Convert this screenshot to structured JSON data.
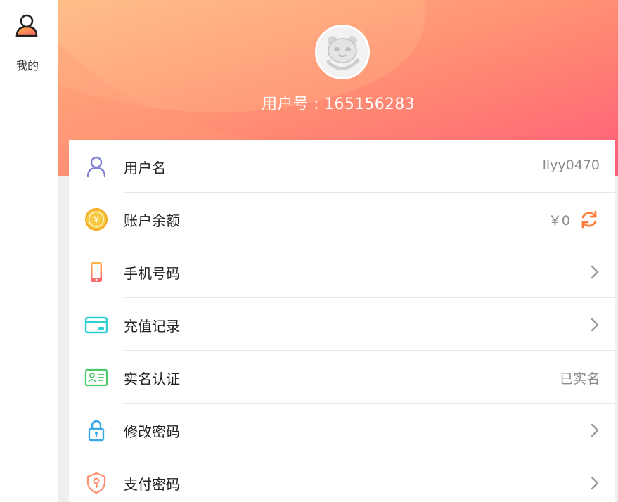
{
  "nav": {
    "mine_label": "我的",
    "mine_icon": "user-icon"
  },
  "header": {
    "user_id_text": "用户号 : 165156283",
    "avatar_icon": "panda-avatar-icon"
  },
  "rows": [
    {
      "label": "用户名",
      "value": "llyy0470",
      "icon": "user-outline-icon",
      "icon_color": "#7f7fd5"
    },
    {
      "label": "账户余额",
      "value": "￥0",
      "icon": "coin-icon",
      "icon_color": "#f7b733",
      "action_icon": "refresh-icon"
    },
    {
      "label": "手机号码",
      "value": "",
      "icon": "phone-icon",
      "icon_color": "#ff7b54"
    },
    {
      "label": "充值记录",
      "value": "",
      "icon": "card-icon",
      "icon_color": "#2ecfd0"
    },
    {
      "label": "实名认证",
      "value": "已实名",
      "icon": "id-card-icon",
      "icon_color": "#4cc96b"
    },
    {
      "label": "修改密码",
      "value": "",
      "icon": "lock-icon",
      "icon_color": "#3aa8e6"
    },
    {
      "label": "支付密码",
      "value": "",
      "icon": "shield-key-icon",
      "icon_color": "#ff8f6f"
    }
  ],
  "colors": {
    "banner_start": "#ffb27a",
    "banner_end": "#ff5f7a",
    "accent_orange": "#ff7b3a"
  }
}
